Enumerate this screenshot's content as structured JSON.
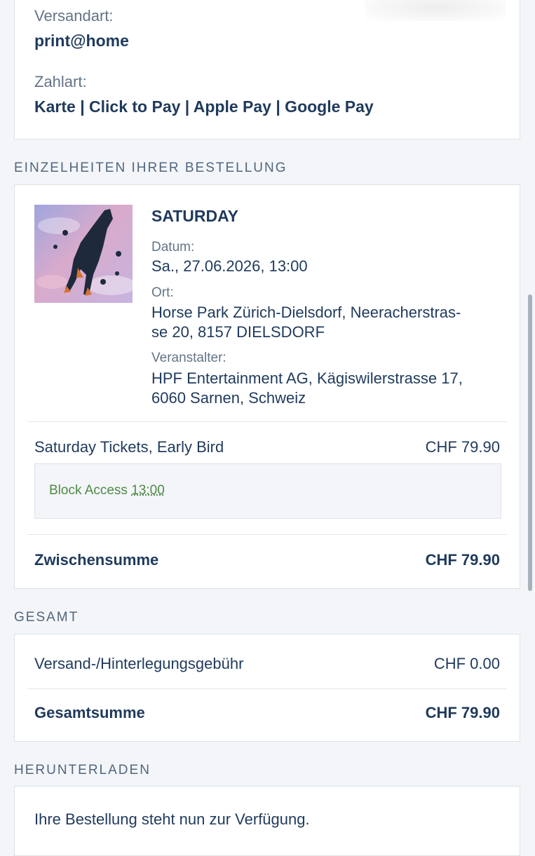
{
  "shipping": {
    "label": "Versandart:",
    "value": "print@home"
  },
  "payment": {
    "label": "Zahlart:",
    "value": "Karte | Click to Pay | Apple Pay | Google Pay"
  },
  "order_details": {
    "heading": "EINZELHEITEN IHRER BESTELLUNG",
    "event": {
      "title": "SATURDAY",
      "date_label": "Datum:",
      "date_value": "Sa., 27.06.2026, 13:00",
      "venue_label": "Ort:",
      "venue_line1": "Horse Park Zürich-Dielsdorf, Neeracherstras-",
      "venue_line2": "se 20, 8157 DIELSDORF",
      "organizer_label": "Veranstalter:",
      "organizer_line1": "HPF Entertainment AG, Kägiswilerstrasse 17,",
      "organizer_line2": "6060 Sarnen, Schweiz"
    },
    "ticket": {
      "label": "Saturday Tickets, Early Bird",
      "price": "CHF 79.90"
    },
    "block": {
      "label": "Block Access",
      "time": "13:00"
    },
    "subtotal": {
      "label": "Zwischensumme",
      "price": "CHF 79.90"
    }
  },
  "total": {
    "heading": "GESAMT",
    "fee": {
      "label": "Versand-/Hinterlegungsgebühr",
      "price": "CHF 0.00"
    },
    "grand": {
      "label": "Gesamtsumme",
      "price": "CHF 79.90"
    }
  },
  "download": {
    "heading": "HERUNTERLADEN",
    "message": "Ihre Bestellung steht nun zur Verfügung."
  },
  "colors": {
    "text": "#1f3a5c",
    "muted": "#637487",
    "green": "#4f8a46",
    "background": "#f3f5f8"
  }
}
